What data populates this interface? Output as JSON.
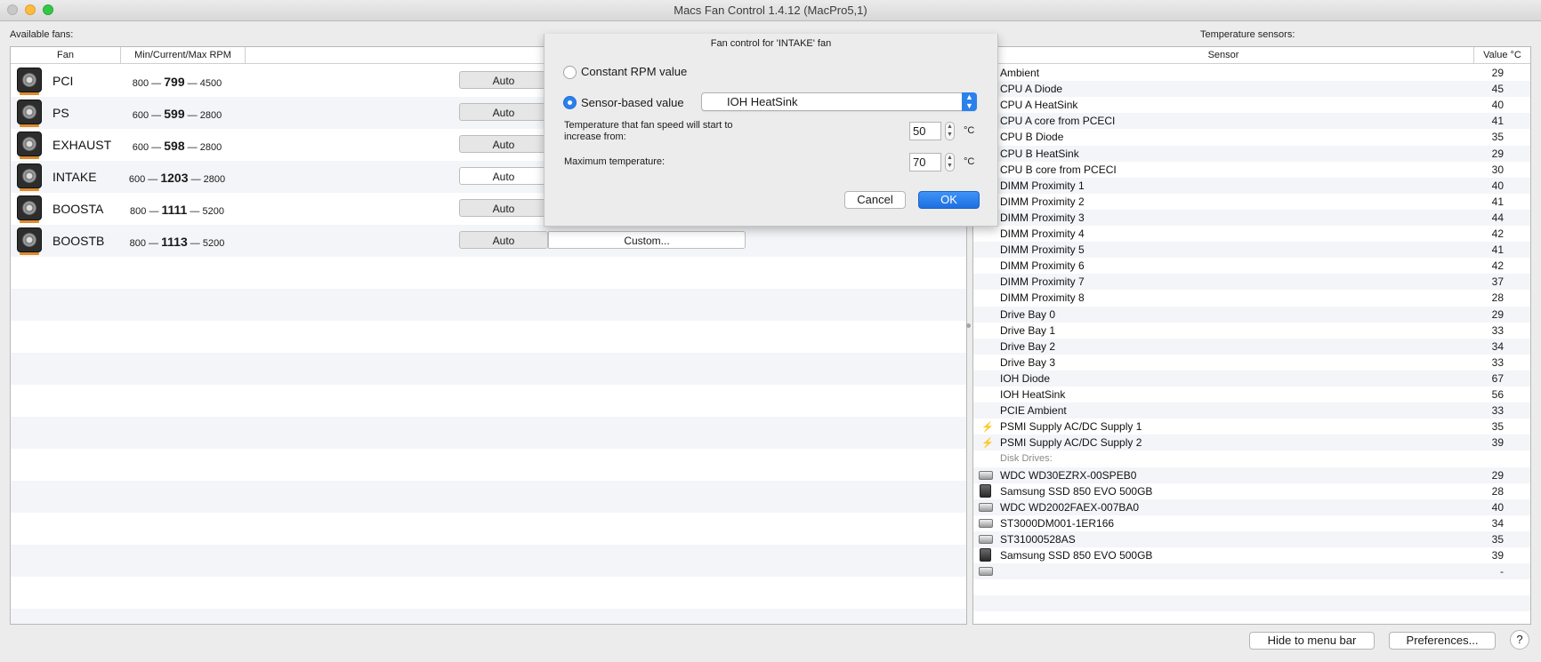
{
  "window": {
    "title": "Macs Fan Control 1.4.12 (MacPro5,1)"
  },
  "fans_panel": {
    "label": "Available fans:",
    "headers": {
      "fan": "Fan",
      "rpm": "Min/Current/Max RPM"
    },
    "fans": [
      {
        "name": "PCI",
        "min": "800",
        "current": "799",
        "max": "4500",
        "auto_label": "Auto",
        "auto_selected": false
      },
      {
        "name": "PS",
        "min": "600",
        "current": "599",
        "max": "2800",
        "auto_label": "Auto",
        "auto_selected": false
      },
      {
        "name": "EXHAUST",
        "min": "600",
        "current": "598",
        "max": "2800",
        "auto_label": "Auto",
        "auto_selected": false
      },
      {
        "name": "INTAKE",
        "min": "600",
        "current": "1203",
        "max": "2800",
        "auto_label": "Auto",
        "auto_selected": true
      },
      {
        "name": "BOOSTA",
        "min": "800",
        "current": "1111",
        "max": "5200",
        "auto_label": "Auto",
        "auto_selected": false
      },
      {
        "name": "BOOSTB",
        "min": "800",
        "current": "1113",
        "max": "5200",
        "auto_label": "Auto",
        "auto_selected": false,
        "custom_label": "Custom..."
      }
    ]
  },
  "sensors_panel": {
    "label": "Temperature sensors:",
    "headers": {
      "sensor": "Sensor",
      "value": "Value °C"
    },
    "sensors": [
      {
        "name": "Ambient",
        "value": "29"
      },
      {
        "name": "CPU A Diode",
        "value": "45"
      },
      {
        "name": "CPU A HeatSink",
        "value": "40"
      },
      {
        "name": "CPU A core from PCECI",
        "value": "41"
      },
      {
        "name": "CPU B Diode",
        "value": "35"
      },
      {
        "name": "CPU B HeatSink",
        "value": "29"
      },
      {
        "name": "CPU B core from PCECI",
        "value": "30"
      },
      {
        "name": "DIMM Proximity 1",
        "value": "40"
      },
      {
        "name": "DIMM Proximity 2",
        "value": "41"
      },
      {
        "name": "DIMM Proximity 3",
        "value": "44"
      },
      {
        "name": "DIMM Proximity 4",
        "value": "42"
      },
      {
        "name": "DIMM Proximity 5",
        "value": "41"
      },
      {
        "name": "DIMM Proximity 6",
        "value": "42"
      },
      {
        "name": "DIMM Proximity 7",
        "value": "37"
      },
      {
        "name": "DIMM Proximity 8",
        "value": "28"
      },
      {
        "name": "Drive Bay 0",
        "value": "29"
      },
      {
        "name": "Drive Bay 1",
        "value": "33"
      },
      {
        "name": "Drive Bay 2",
        "value": "34"
      },
      {
        "name": "Drive Bay 3",
        "value": "33"
      },
      {
        "name": "IOH Diode",
        "value": "67"
      },
      {
        "name": "IOH HeatSink",
        "value": "56"
      },
      {
        "name": "PCIE Ambient",
        "value": "33"
      },
      {
        "name": "PSMI Supply AC/DC Supply 1",
        "value": "35",
        "icon": "power-bolt-icon"
      },
      {
        "name": "PSMI Supply AC/DC Supply 2",
        "value": "39",
        "icon": "power-bolt-icon"
      },
      {
        "name": "Disk Drives:",
        "value": "",
        "group": true
      },
      {
        "name": "WDC WD30EZRX-00SPEB0",
        "value": "29",
        "icon": "hard-disk-icon"
      },
      {
        "name": "Samsung SSD 850 EVO 500GB",
        "value": "28",
        "icon": "ssd-icon"
      },
      {
        "name": "WDC WD2002FAEX-007BA0",
        "value": "40",
        "icon": "hard-disk-icon"
      },
      {
        "name": "ST3000DM001-1ER166",
        "value": "34",
        "icon": "hard-disk-icon"
      },
      {
        "name": "ST31000528AS",
        "value": "35",
        "icon": "hard-disk-icon"
      },
      {
        "name": "Samsung SSD 850 EVO 500GB",
        "value": "39",
        "icon": "ssd-icon"
      },
      {
        "name": "",
        "value": "-",
        "icon": "hard-disk-icon"
      }
    ]
  },
  "dialog": {
    "title": "Fan control for 'INTAKE' fan",
    "option_constant": "Constant RPM value",
    "option_sensor": "Sensor-based value",
    "selected_option": "sensor",
    "sensor_selected": "IOH HeatSink",
    "start_temp_label": "Temperature that fan speed will start to increase from:",
    "start_temp_value": "50",
    "max_temp_label": "Maximum temperature:",
    "max_temp_value": "70",
    "unit": "°C",
    "cancel_label": "Cancel",
    "ok_label": "OK",
    "accent_color": "#2a81ec"
  },
  "footer": {
    "hide_label": "Hide to menu bar",
    "preferences_label": "Preferences...",
    "help_label": "?"
  }
}
